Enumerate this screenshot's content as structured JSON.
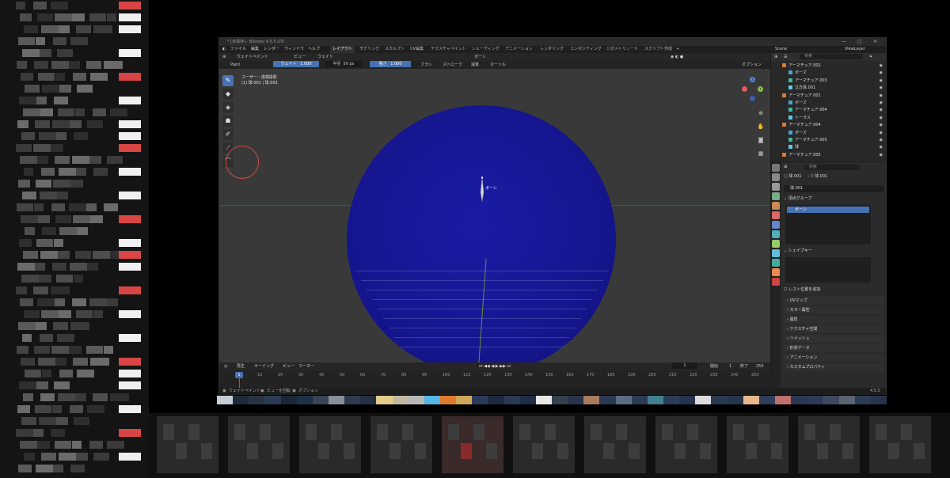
{
  "window": {
    "title": "* [未保存] - Blender 4.5.5 LTS",
    "controls": [
      "—",
      "▢",
      "✕"
    ]
  },
  "menubar": {
    "items": [
      "ファイル",
      "編集",
      "レンダー",
      "ウィンドウ",
      "ヘルプ"
    ],
    "workspaces": [
      "レイアウト",
      "モデリング",
      "スカルプト",
      "UV編集",
      "テクスチャペイント",
      "シェーディング",
      "アニメーション",
      "レンダリング",
      "コンポジティング",
      "ジオメトリノード",
      "スクリプト作成",
      "+"
    ],
    "active_workspace": "レイアウト",
    "scene_label": "Scene",
    "viewlayer_label": "ViewLayer"
  },
  "header1": {
    "mode": "ウェイトペイント",
    "view": "ビュー",
    "weight": "ウェイト",
    "bone_dropdown": "ボーン",
    "options": "オプション"
  },
  "header2": {
    "brush": "Paint",
    "weight_label": "ウェイト",
    "weight_value": "1.000",
    "radius_label": "半径",
    "radius_value": "50 px",
    "strength_label": "強さ",
    "strength_value": "1.000",
    "brush_menu": "ブラシ",
    "stroke_menu": "ストローク",
    "falloff_menu": "減衰",
    "cursor_menu": "カーソル"
  },
  "viewport": {
    "info_line1": "ユーザー・透視投影",
    "info_line2": "(1) 球.001 | 球.001",
    "bone_label": "ボーン",
    "sphere_color": "#15168f",
    "background_color": "#393939"
  },
  "tools": [
    "✎",
    "◆",
    "◈",
    "☗",
    "✐",
    "⟋",
    "⌒"
  ],
  "timeline": {
    "play_menu": "再生",
    "keying_menu": "キーイング",
    "view_menu": "ビュー",
    "marker_menu": "マーカー",
    "current_frame": "1",
    "start_label": "開始",
    "start_value": "1",
    "end_label": "終了",
    "end_value": "250",
    "ticks": [
      "1",
      "10",
      "20",
      "30",
      "40",
      "50",
      "60",
      "70",
      "80",
      "90",
      "100",
      "110",
      "120",
      "130",
      "140",
      "150",
      "160",
      "170",
      "180",
      "190",
      "200",
      "210",
      "220",
      "230",
      "240",
      "250"
    ]
  },
  "statusbar": {
    "left1": "ウェイトペイント",
    "left2": "ビューを回転",
    "left3": "オプション",
    "version": "4.5.5"
  },
  "outliner": {
    "search_placeholder": "検索",
    "rows": [
      {
        "label": "アーマチュア.002",
        "indent": 1,
        "kind": "armature"
      },
      {
        "label": "ポーズ",
        "indent": 2,
        "kind": "pose"
      },
      {
        "label": "アーマチュア.003",
        "indent": 2,
        "kind": "armdata"
      },
      {
        "label": "立方体.001",
        "indent": 2,
        "kind": "mesh"
      },
      {
        "label": "アーマチュア.001",
        "indent": 1,
        "kind": "armature"
      },
      {
        "label": "ポーズ",
        "indent": 2,
        "kind": "pose"
      },
      {
        "label": "アーマチュア.004",
        "indent": 2,
        "kind": "armdata"
      },
      {
        "label": "トーラス",
        "indent": 2,
        "kind": "mesh"
      },
      {
        "label": "アーマチュア.004",
        "indent": 1,
        "kind": "armature"
      },
      {
        "label": "ポーズ",
        "indent": 2,
        "kind": "pose"
      },
      {
        "label": "アーマチュア.005",
        "indent": 2,
        "kind": "armdata"
      },
      {
        "label": "球",
        "indent": 2,
        "kind": "mesh"
      },
      {
        "label": "アーマチュア.005",
        "indent": 1,
        "kind": "armature"
      }
    ]
  },
  "properties": {
    "search_placeholder": "検索",
    "object_name": "球.001",
    "mesh_name": "球.001",
    "data_name": "球.001",
    "vertex_groups_title": "頂点グループ",
    "vertex_group_item": "ボーン",
    "shape_keys_title": "シェイプキー",
    "rest_position_label": "レスト位置を追加",
    "collapsed_panels": [
      "UVマップ",
      "カラー属性",
      "属性",
      "テクスチャ空間",
      "リメッシュ",
      "形状データ",
      "アニメーション",
      "カスタムプロパティ"
    ]
  },
  "swatch_colors": [
    "#c6cdd6",
    "#1f2a3a",
    "#2a3440",
    "#2b3b55",
    "#1b2636",
    "#203048",
    "#394455",
    "#8a8e98",
    "#2e3a4e",
    "#233044",
    "#e3cc8a",
    "#c2b9a3",
    "#b7b7b7",
    "#55b7e6",
    "#e07a2e",
    "#cfa65a",
    "#2a3b5a",
    "#1d2a42",
    "#2a3a56",
    "#1f2d46",
    "#e8e8e8",
    "#35404f",
    "#28344a",
    "#a77b5d",
    "#2b3955",
    "#5b6d84",
    "#2d3a55",
    "#3f7f8f",
    "#2b3c58",
    "#253350",
    "#dcdcdc",
    "#2a3a52",
    "#27364e",
    "#e8b88b",
    "#2e3e5c",
    "#c16f6f",
    "#2a3752",
    "#2b3a57",
    "#3d495e",
    "#5a6371",
    "#2c3b56",
    "#27344c"
  ]
}
